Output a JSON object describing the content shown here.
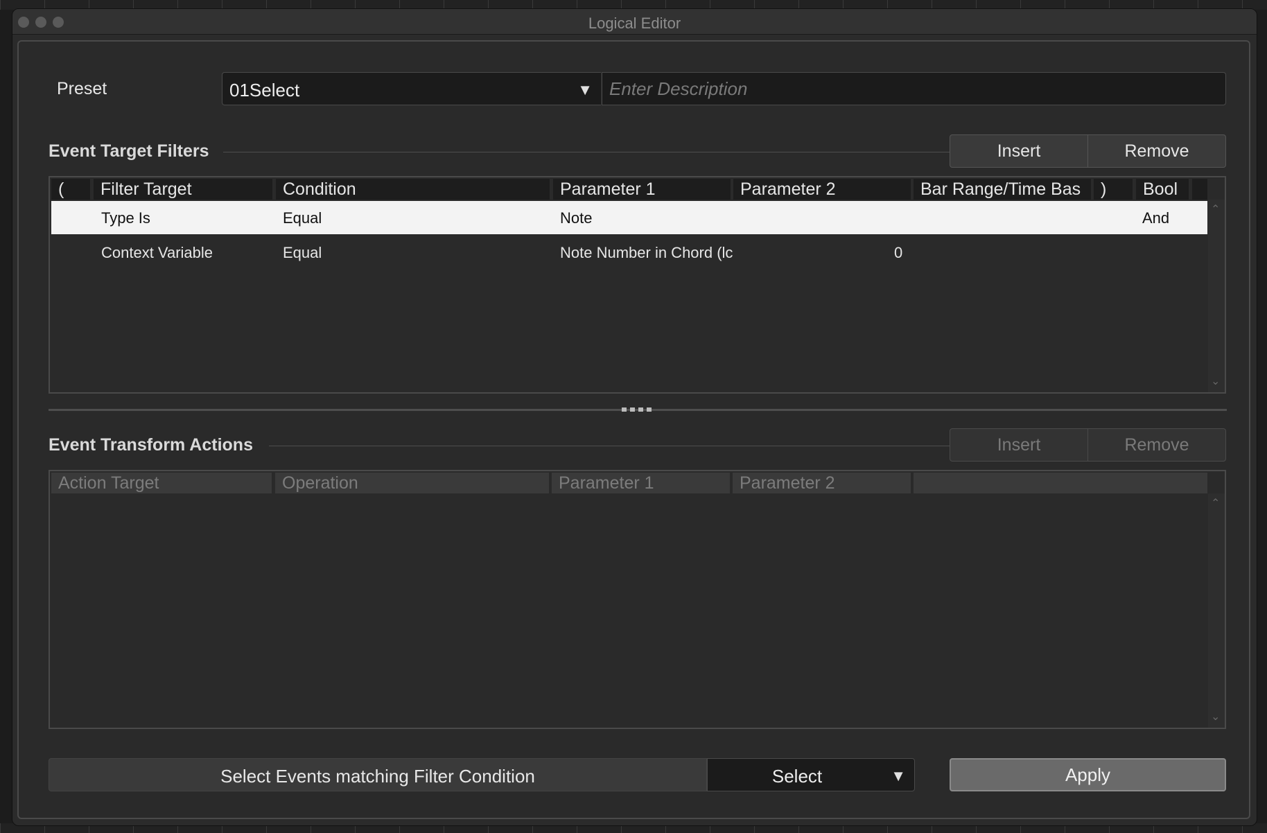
{
  "window": {
    "title": "Logical Editor"
  },
  "preset": {
    "label": "Preset",
    "value": "01Select",
    "description_placeholder": "Enter Description"
  },
  "filters": {
    "title": "Event Target Filters",
    "insert_label": "Insert",
    "remove_label": "Remove",
    "columns": [
      "(",
      "Filter Target",
      "Condition",
      "Parameter 1",
      "Parameter 2",
      "Bar Range/Time Bas",
      ")",
      "Bool"
    ],
    "rows": [
      {
        "open": "",
        "filter_target": "Type Is",
        "condition": "Equal",
        "parameter1": "Note",
        "parameter2": "",
        "bar_range": "",
        "close": "",
        "bool": "And",
        "selected": true
      },
      {
        "open": "",
        "filter_target": "Context Variable",
        "condition": "Equal",
        "parameter1": "Note Number in Chord (lc",
        "parameter2": "0",
        "bar_range": "",
        "close": "",
        "bool": "",
        "selected": false
      }
    ]
  },
  "actions": {
    "title": "Event Transform Actions",
    "insert_label": "Insert",
    "remove_label": "Remove",
    "columns": [
      "Action Target",
      "Operation",
      "Parameter 1",
      "Parameter 2",
      ""
    ]
  },
  "function": {
    "description": "Select Events matching Filter Condition",
    "value": "Select",
    "apply_label": "Apply"
  },
  "icons": {
    "dropdown": "triangle-down-icon",
    "scroll_up": "chevron-up-icon",
    "scroll_down": "chevron-down-icon"
  }
}
